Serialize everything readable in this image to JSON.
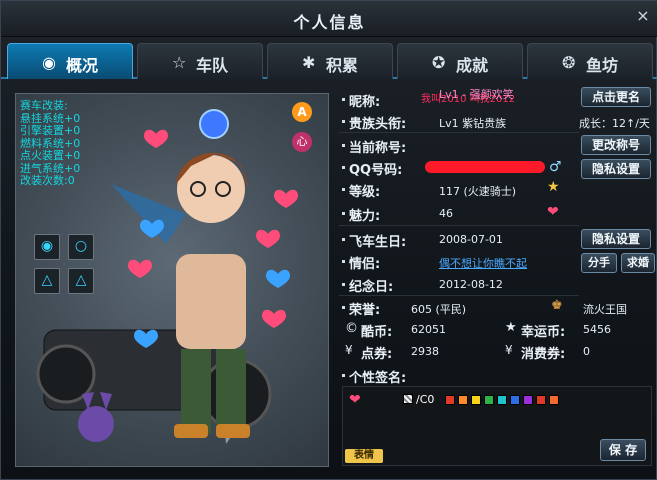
{
  "window": {
    "title": "个人信息",
    "close": "×"
  },
  "tabs": [
    {
      "label": "概况",
      "icon": "gauge-icon",
      "active": true
    },
    {
      "label": "车队",
      "icon": "star-icon"
    },
    {
      "label": "积累",
      "icon": "gear-icon"
    },
    {
      "label": "成就",
      "icon": "medal-icon"
    },
    {
      "label": "鱼坊",
      "icon": "fish-icon"
    }
  ],
  "character_stats": [
    "赛车改装:",
    "悬挂系统+0",
    "引擎装置+0",
    "燃料系统+0",
    "点火装置+0",
    "进气系统+0",
    "改装次数:0"
  ],
  "badges": {
    "a": "A",
    "b": "心"
  },
  "profile": {
    "nickname_label": "昵称:",
    "nickname_value": "Lv1 - 强颜欢笑",
    "nickname_overlay": "我叫2010 叫我2012",
    "noble_label": "贵族头衔:",
    "noble_value": "Lv1  紫钻贵族",
    "growth": "成长：12↑/天",
    "current_title_label": "当前称号:",
    "qq_label": "QQ号码:",
    "level_label": "等级:",
    "level_value": "117 (火速骑士)",
    "charm_label": "魅力:",
    "charm_value": "46",
    "birthday_label": "飞车生日:",
    "birthday_value": "2008-07-01",
    "partner_label": "情侣:",
    "partner_value": "偶不想让你瞧不起",
    "anniversary_label": "纪念日:",
    "anniversary_value": "2012-08-12",
    "honor_label": "荣誉:",
    "honor_value": "605 (平民)",
    "kingdom": "流火王国",
    "kubi_label": "酷币:",
    "kubi_value": "62051",
    "lucky_label": "幸运币:",
    "lucky_value": "5456",
    "dianquan_label": "点券:",
    "dianquan_value": "2938",
    "xiaofei_label": "消费券:",
    "xiaofei_value": "0",
    "signature_label": "个性签名:"
  },
  "buttons": {
    "rename": "点击更名",
    "change_title": "更改称号",
    "privacy1": "隐私设置",
    "privacy2": "隐私设置",
    "breakup": "分手",
    "propose": "求婚",
    "save": "保 存",
    "emoji": "表情"
  },
  "signature_toolbar": {
    "color_code": "/C0"
  },
  "colors": {
    "accent": "#0d7bb2",
    "stat_text": "#14d6de",
    "nickname_red": "#ff2b5a",
    "partner_link": "#4aa8ff",
    "swatches": [
      "#e23a2a",
      "#ff8a2a",
      "#f5d21c",
      "#2db34a",
      "#1fc3c9",
      "#2b6ee8",
      "#9b2fe0",
      "#e23a2a",
      "#f56a2a"
    ]
  }
}
